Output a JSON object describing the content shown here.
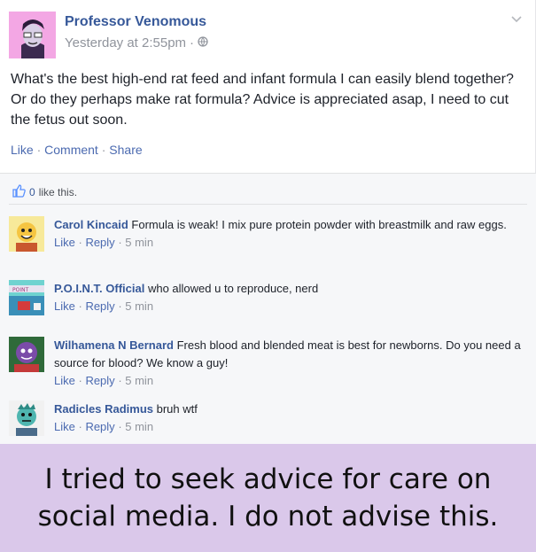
{
  "post": {
    "author": "Professor Venomous",
    "timestamp": "Yesterday at 2:55pm",
    "audience_icon": "globe-icon",
    "body": "What's the best high-end rat feed and infant formula I can easily blend together? Or do they perhaps make rat formula? Advice is appreciated asap, I need to cut  the fetus out soon.",
    "actions": {
      "like": "Like",
      "comment": "Comment",
      "share": "Share"
    }
  },
  "likes": {
    "count": "0",
    "label": "like this."
  },
  "comments": [
    {
      "name": "Carol Kincaid",
      "text": "Formula is weak! I mix pure protein powder with breastmilk and raw eggs.",
      "like": "Like",
      "reply": "Reply",
      "time": "5 min"
    },
    {
      "name": "P.O.I.N.T. Official",
      "text": "who allowed u to reproduce, nerd",
      "like": "Like",
      "reply": "Reply",
      "time": "5 min"
    },
    {
      "name": "Wilhamena N Bernard",
      "text": "Fresh blood and blended meat is best for newborns. Do you need a source for blood? We know a guy!",
      "like": "Like",
      "reply": "Reply",
      "time": "5 min"
    },
    {
      "name": "Radicles Radimus",
      "text": "bruh wtf",
      "like": "Like",
      "reply": "Reply",
      "time": "5 min"
    }
  ],
  "caption": "I tried to seek advice for care on social media. I do not advise this.",
  "colors": {
    "link": "#365899",
    "muted": "#90949c",
    "caption_bg": "#dac8ea",
    "comments_bg": "#f6f7f9"
  }
}
